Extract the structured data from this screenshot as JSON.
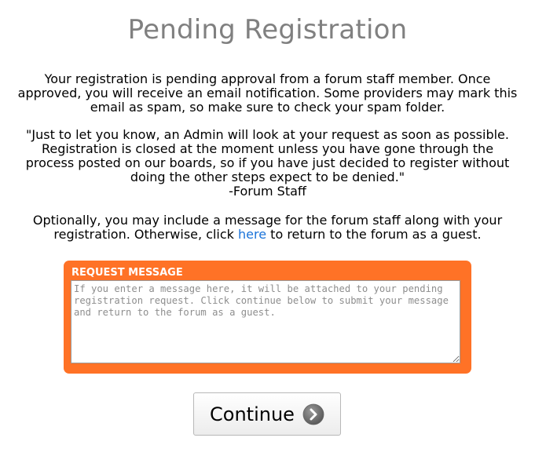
{
  "page": {
    "title": "Pending Registration"
  },
  "intro": {
    "text": "Your registration is pending approval from a forum staff member. Once approved, you will receive an email notification. Some providers may mark this email as spam, so make sure to check your spam folder."
  },
  "staff_message": {
    "quote": "\"Just to let you know, an Admin will look at your request as soon as possible. Registration is closed at the moment unless you have gone through the process posted on our boards, so if you have just decided to register without doing the other steps expect to be denied.\"",
    "signature": "-Forum Staff"
  },
  "optional": {
    "text_before_link": "Optionally, you may include a message for the forum staff along with your registration. Otherwise, click ",
    "link_text": "here",
    "text_after_link": " to return to the forum as a guest."
  },
  "request": {
    "label": "REQUEST MESSAGE",
    "value": "",
    "placeholder": "If you enter a message here, it will be attached to your pending registration request. Click continue below to submit your message and return to the forum as a guest."
  },
  "continue_button": {
    "label": "Continue",
    "icon": "arrow-right-circle-icon"
  },
  "colors": {
    "title": "#808080",
    "accent_orange": "#ff7226",
    "link": "#1a73d9"
  }
}
